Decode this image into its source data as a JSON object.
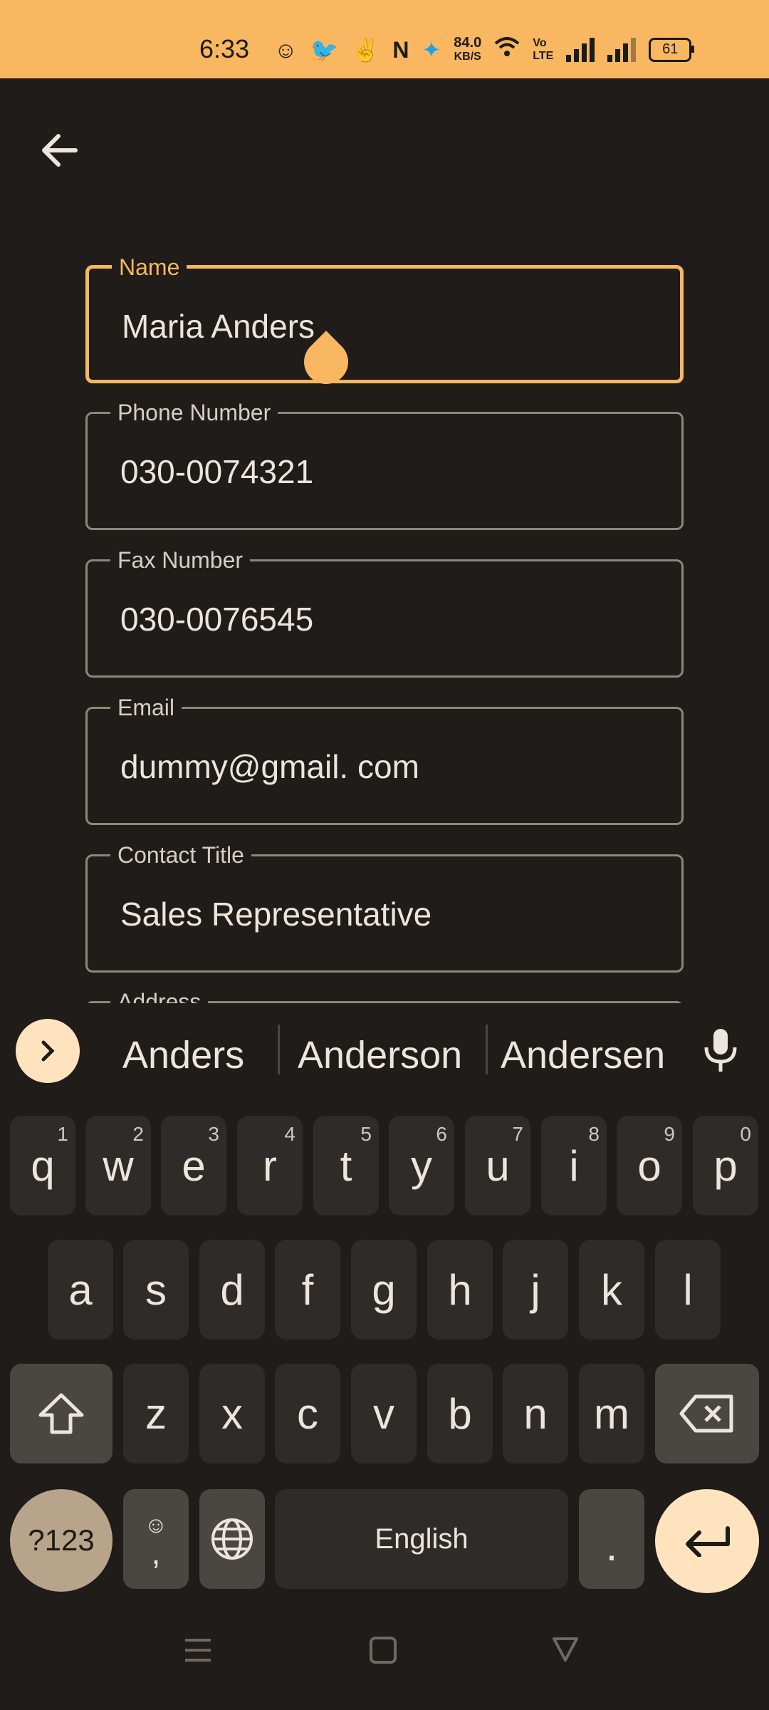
{
  "status_bar": {
    "time": "6:33",
    "network_speed_top": "84.0",
    "network_speed_unit": "KB/S",
    "battery": "61"
  },
  "form": {
    "fields": [
      {
        "label": "Name",
        "value": "Maria Anders"
      },
      {
        "label": "Phone Number",
        "value": "030-0074321"
      },
      {
        "label": "Fax Number",
        "value": "030-0076545"
      },
      {
        "label": "Email",
        "value": "dummy@gmail. com"
      },
      {
        "label": "Contact Title",
        "value": "Sales Representative"
      },
      {
        "label": "Address",
        "value": ""
      }
    ]
  },
  "suggestions": [
    "Anders",
    "Anderson",
    "Andersen"
  ],
  "keyboard": {
    "row1": [
      "q",
      "w",
      "e",
      "r",
      "t",
      "y",
      "u",
      "i",
      "o",
      "p"
    ],
    "row1_hints": [
      "1",
      "2",
      "3",
      "4",
      "5",
      "6",
      "7",
      "8",
      "9",
      "0"
    ],
    "row2": [
      "a",
      "s",
      "d",
      "f",
      "g",
      "h",
      "j",
      "k",
      "l"
    ],
    "row3": [
      "z",
      "x",
      "c",
      "v",
      "b",
      "n",
      "m"
    ],
    "symbols_label": "?123",
    "comma": ",",
    "space_label": "English",
    "period": "."
  },
  "colors": {
    "accent": "#f8b760",
    "background": "#1f1c19",
    "key": "#2f2b28"
  }
}
